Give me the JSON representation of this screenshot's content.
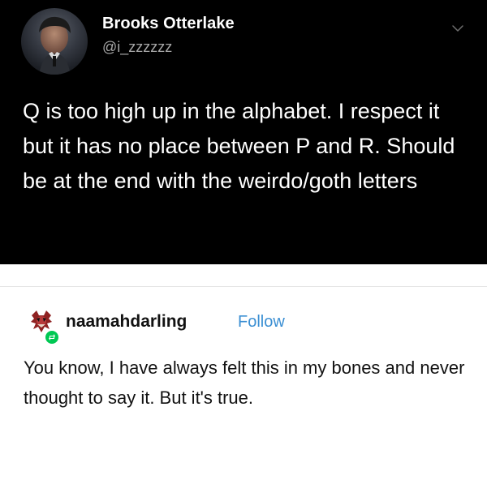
{
  "tweet": {
    "author_name": "Brooks Otterlake",
    "handle": "@i_zzzzzz",
    "text": "Q is too high up in the alphabet. I respect it but it has no place between P and R. Should be at the end with the weirdo/goth letters"
  },
  "tumblr": {
    "username": "naamahdarling",
    "follow_label": "Follow",
    "text": "You know, I have always felt this in my bones and never thought to say it. But it's true."
  },
  "colors": {
    "tweet_background": "#000000",
    "tweet_handle": "#a7a7a7",
    "follow_accent": "#3b8fd3",
    "reblog_badge": "#00c853"
  },
  "icons": {
    "chevron": "chevron-down-icon",
    "reblog": "reblog-icon"
  }
}
